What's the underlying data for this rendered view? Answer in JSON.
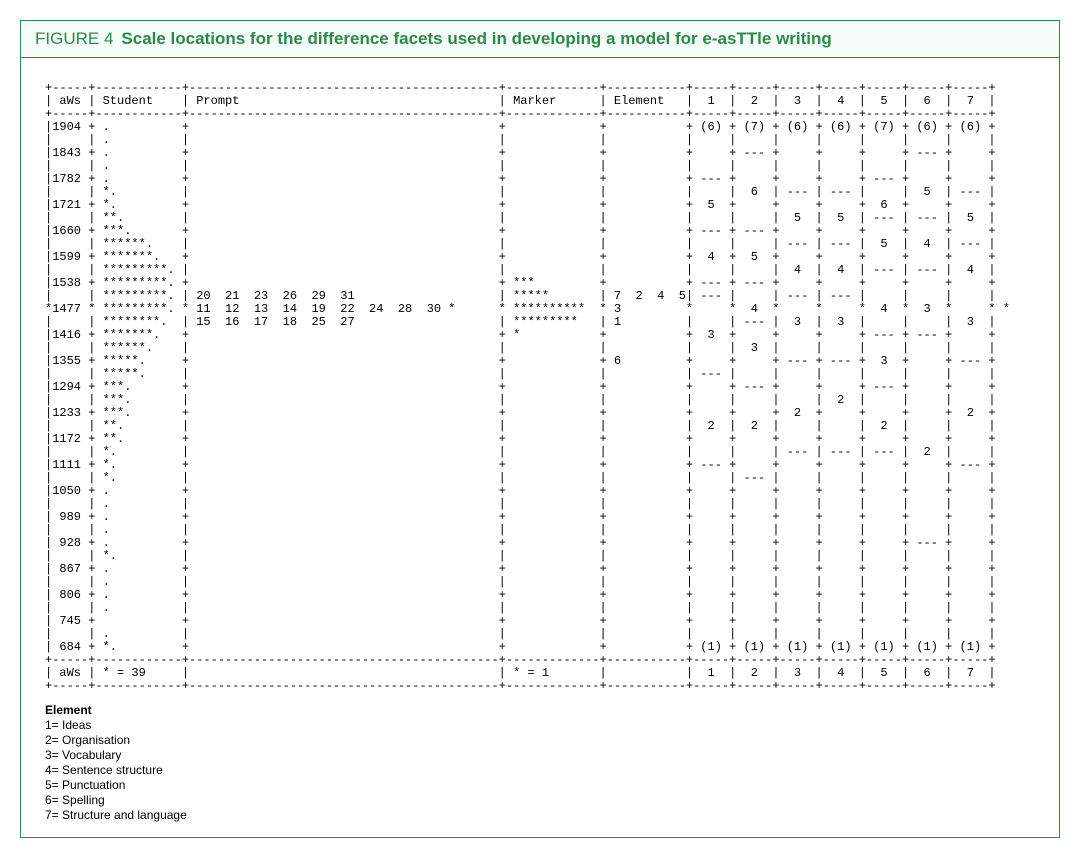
{
  "figure": {
    "label": "FIGURE 4",
    "title": "Scale locations for the difference facets used in developing a model for e-asTTle writing"
  },
  "header": {
    "col1": " aWs ",
    "col2": " Student    ",
    "col3": " Prompt                                    ",
    "col4": " Marker      ",
    "col5": " Element   ",
    "c1": "  1  ",
    "c2": "  2  ",
    "c3": "  3  ",
    "c4": "  4  ",
    "c5": "  5  ",
    "c6": "  6  ",
    "c7": "  7  "
  },
  "rows": [
    {
      "aws": "1904",
      "r": "+",
      "stu": " .          ",
      "pr": "                                           ",
      "mk": "             ",
      "el": "           ",
      "t": "+",
      "c": [
        " (6) ",
        " (7) ",
        " (6) ",
        " (6) ",
        " (7) ",
        " (6) ",
        " (6) "
      ]
    },
    {
      "aws": "    ",
      "r": "|",
      "stu": " .          ",
      "pr": "                                           ",
      "mk": "             ",
      "el": "           ",
      "t": "|",
      "c": [
        "     ",
        "     ",
        "     ",
        "     ",
        "     ",
        "     ",
        "     "
      ]
    },
    {
      "aws": "1843",
      "r": "+",
      "stu": " .          ",
      "pr": "                                           ",
      "mk": "             ",
      "el": "           ",
      "t": "+",
      "c": [
        "     ",
        " --- ",
        "     ",
        "     ",
        "     ",
        " --- ",
        "     "
      ]
    },
    {
      "aws": "    ",
      "r": "|",
      "stu": " .          ",
      "pr": "                                           ",
      "mk": "             ",
      "el": "           ",
      "t": "|",
      "c": [
        "     ",
        "     ",
        "     ",
        "     ",
        "     ",
        "     ",
        "     "
      ]
    },
    {
      "aws": "1782",
      "r": "+",
      "stu": " .          ",
      "pr": "                                           ",
      "mk": "             ",
      "el": "           ",
      "t": "+",
      "c": [
        " --- ",
        "     ",
        "     ",
        "     ",
        " --- ",
        "     ",
        "     "
      ]
    },
    {
      "aws": "    ",
      "r": "|",
      "stu": " *.         ",
      "pr": "                                           ",
      "mk": "             ",
      "el": "           ",
      "t": "|",
      "c": [
        "     ",
        "  6  ",
        " --- ",
        " --- ",
        "     ",
        "  5  ",
        " --- "
      ]
    },
    {
      "aws": "1721",
      "r": "+",
      "stu": " *.         ",
      "pr": "                                           ",
      "mk": "             ",
      "el": "           ",
      "t": "+",
      "c": [
        "  5  ",
        "     ",
        "     ",
        "     ",
        "  6  ",
        "     ",
        "     "
      ]
    },
    {
      "aws": "    ",
      "r": "|",
      "stu": " **.        ",
      "pr": "                                           ",
      "mk": "             ",
      "el": "           ",
      "t": "|",
      "c": [
        "     ",
        "     ",
        "  5  ",
        "  5  ",
        " --- ",
        " --- ",
        "  5  "
      ]
    },
    {
      "aws": "1660",
      "r": "+",
      "stu": " ***.       ",
      "pr": "                                           ",
      "mk": "             ",
      "el": "           ",
      "t": "+",
      "c": [
        " --- ",
        " --- ",
        "     ",
        "     ",
        "     ",
        "     ",
        "     "
      ]
    },
    {
      "aws": "    ",
      "r": "|",
      "stu": " ******.    ",
      "pr": "                                           ",
      "mk": "             ",
      "el": "           ",
      "t": "|",
      "c": [
        "     ",
        "     ",
        " --- ",
        " --- ",
        "  5  ",
        "  4  ",
        " --- "
      ]
    },
    {
      "aws": "1599",
      "r": "+",
      "stu": " *******.   ",
      "pr": "                                           ",
      "mk": "             ",
      "el": "           ",
      "t": "+",
      "c": [
        "  4  ",
        "  5  ",
        "     ",
        "     ",
        "     ",
        "     ",
        "     "
      ]
    },
    {
      "aws": "    ",
      "r": "|",
      "stu": " *********. ",
      "pr": "                                           ",
      "mk": "             ",
      "el": "           ",
      "t": "|",
      "c": [
        "     ",
        "     ",
        "  4  ",
        "  4  ",
        " --- ",
        " --- ",
        "  4  "
      ]
    },
    {
      "aws": "1538",
      "r": "+",
      "stu": " *********. ",
      "pr": "                                           ",
      "mk": " ***         ",
      "el": "           ",
      "t": "+",
      "c": [
        " --- ",
        " --- ",
        "     ",
        "     ",
        "     ",
        "     ",
        "     "
      ]
    },
    {
      "aws": "    ",
      "r": "|",
      "stu": " *********. ",
      "pr": " 20  21  23  26  29  31                    ",
      "mk": " *****       ",
      "el": " 7  2  4  5",
      "t": "|",
      "c": [
        " --- ",
        "     ",
        " --- ",
        " --- ",
        "     ",
        "     ",
        "     "
      ]
    },
    {
      "aws": "1477",
      "r": "*",
      "stu": " *********. ",
      "pr": " 11  12  13  14  19  22  24  28  30 *",
      "mk": " **********  ",
      "el": " 3         ",
      "t": "*",
      "c": [
        "     ",
        "  4  ",
        "     ",
        "     ",
        "  4  ",
        "  3  ",
        "     "
      ]
    },
    {
      "aws": "    ",
      "r": "|",
      "stu": " ********.  ",
      "pr": " 15  16  17  18  25  27                    ",
      "mk": " *********   ",
      "el": " 1         ",
      "t": "|",
      "c": [
        "     ",
        " --- ",
        "  3  ",
        "  3  ",
        "     ",
        "     ",
        "  3  "
      ]
    },
    {
      "aws": "1416",
      "r": "+",
      "stu": " *******.   ",
      "pr": "                                           ",
      "mk": " *           ",
      "el": "           ",
      "t": "+",
      "c": [
        "  3  ",
        "     ",
        "     ",
        "     ",
        " --- ",
        " --- ",
        "     "
      ]
    },
    {
      "aws": "    ",
      "r": "|",
      "stu": " ******.    ",
      "pr": "                                           ",
      "mk": "             ",
      "el": "           ",
      "t": "|",
      "c": [
        "     ",
        "  3  ",
        "     ",
        "     ",
        "     ",
        "     ",
        "     "
      ]
    },
    {
      "aws": "1355",
      "r": "+",
      "stu": " *****.     ",
      "pr": "                                           ",
      "mk": "             ",
      "el": " 6         ",
      "t": "+",
      "c": [
        "     ",
        "     ",
        " --- ",
        " --- ",
        "  3  ",
        "     ",
        " --- "
      ]
    },
    {
      "aws": "    ",
      "r": "|",
      "stu": " *****.     ",
      "pr": "                                           ",
      "mk": "             ",
      "el": "           ",
      "t": "|",
      "c": [
        " --- ",
        "     ",
        "     ",
        "     ",
        "     ",
        "     ",
        "     "
      ]
    },
    {
      "aws": "1294",
      "r": "+",
      "stu": " ***.       ",
      "pr": "                                           ",
      "mk": "             ",
      "el": "           ",
      "t": "+",
      "c": [
        "     ",
        " --- ",
        "     ",
        "     ",
        " --- ",
        "     ",
        "     "
      ]
    },
    {
      "aws": "    ",
      "r": "|",
      "stu": " ***.       ",
      "pr": "                                           ",
      "mk": "             ",
      "el": "           ",
      "t": "|",
      "c": [
        "     ",
        "     ",
        "     ",
        "  2  ",
        "     ",
        "     ",
        "     "
      ]
    },
    {
      "aws": "1233",
      "r": "+",
      "stu": " ***.       ",
      "pr": "                                           ",
      "mk": "             ",
      "el": "           ",
      "t": "+",
      "c": [
        "     ",
        "     ",
        "  2  ",
        "     ",
        "     ",
        "     ",
        "  2  "
      ]
    },
    {
      "aws": "    ",
      "r": "|",
      "stu": " **.        ",
      "pr": "                                           ",
      "mk": "             ",
      "el": "           ",
      "t": "|",
      "c": [
        "  2  ",
        "  2  ",
        "     ",
        "     ",
        "  2  ",
        "     ",
        "     "
      ]
    },
    {
      "aws": "1172",
      "r": "+",
      "stu": " **.        ",
      "pr": "                                           ",
      "mk": "             ",
      "el": "           ",
      "t": "+",
      "c": [
        "     ",
        "     ",
        "     ",
        "     ",
        "     ",
        "     ",
        "     "
      ]
    },
    {
      "aws": "    ",
      "r": "|",
      "stu": " *.         ",
      "pr": "                                           ",
      "mk": "             ",
      "el": "           ",
      "t": "|",
      "c": [
        "     ",
        "     ",
        " --- ",
        " --- ",
        " --- ",
        "  2  ",
        "     "
      ]
    },
    {
      "aws": "1111",
      "r": "+",
      "stu": " *.         ",
      "pr": "                                           ",
      "mk": "             ",
      "el": "           ",
      "t": "+",
      "c": [
        " --- ",
        "     ",
        "     ",
        "     ",
        "     ",
        "     ",
        " --- "
      ]
    },
    {
      "aws": "    ",
      "r": "|",
      "stu": " *.         ",
      "pr": "                                           ",
      "mk": "             ",
      "el": "           ",
      "t": "|",
      "c": [
        "     ",
        " --- ",
        "     ",
        "     ",
        "     ",
        "     ",
        "     "
      ]
    },
    {
      "aws": "1050",
      "r": "+",
      "stu": " .          ",
      "pr": "                                           ",
      "mk": "             ",
      "el": "           ",
      "t": "+",
      "c": [
        "     ",
        "     ",
        "     ",
        "     ",
        "     ",
        "     ",
        "     "
      ]
    },
    {
      "aws": "    ",
      "r": "|",
      "stu": " .          ",
      "pr": "                                           ",
      "mk": "             ",
      "el": "           ",
      "t": "|",
      "c": [
        "     ",
        "     ",
        "     ",
        "     ",
        "     ",
        "     ",
        "     "
      ]
    },
    {
      "aws": " 989",
      "r": "+",
      "stu": " .          ",
      "pr": "                                           ",
      "mk": "             ",
      "el": "           ",
      "t": "+",
      "c": [
        "     ",
        "     ",
        "     ",
        "     ",
        "     ",
        "     ",
        "     "
      ]
    },
    {
      "aws": "    ",
      "r": "|",
      "stu": " .          ",
      "pr": "                                           ",
      "mk": "             ",
      "el": "           ",
      "t": "|",
      "c": [
        "     ",
        "     ",
        "     ",
        "     ",
        "     ",
        "     ",
        "     "
      ]
    },
    {
      "aws": " 928",
      "r": "+",
      "stu": " .          ",
      "pr": "                                           ",
      "mk": "             ",
      "el": "           ",
      "t": "+",
      "c": [
        "     ",
        "     ",
        "     ",
        "     ",
        "     ",
        " --- ",
        "     "
      ]
    },
    {
      "aws": "    ",
      "r": "|",
      "stu": " *.         ",
      "pr": "                                           ",
      "mk": "             ",
      "el": "           ",
      "t": "|",
      "c": [
        "     ",
        "     ",
        "     ",
        "     ",
        "     ",
        "     ",
        "     "
      ]
    },
    {
      "aws": " 867",
      "r": "+",
      "stu": " .          ",
      "pr": "                                           ",
      "mk": "             ",
      "el": "           ",
      "t": "+",
      "c": [
        "     ",
        "     ",
        "     ",
        "     ",
        "     ",
        "     ",
        "     "
      ]
    },
    {
      "aws": "    ",
      "r": "|",
      "stu": " .          ",
      "pr": "                                           ",
      "mk": "             ",
      "el": "           ",
      "t": "|",
      "c": [
        "     ",
        "     ",
        "     ",
        "     ",
        "     ",
        "     ",
        "     "
      ]
    },
    {
      "aws": " 806",
      "r": "+",
      "stu": " .          ",
      "pr": "                                           ",
      "mk": "             ",
      "el": "           ",
      "t": "+",
      "c": [
        "     ",
        "     ",
        "     ",
        "     ",
        "     ",
        "     ",
        "     "
      ]
    },
    {
      "aws": "    ",
      "r": "|",
      "stu": " .          ",
      "pr": "                                           ",
      "mk": "             ",
      "el": "           ",
      "t": "|",
      "c": [
        "     ",
        "     ",
        "     ",
        "     ",
        "     ",
        "     ",
        "     "
      ]
    },
    {
      "aws": " 745",
      "r": "+",
      "stu": "            ",
      "pr": "                                           ",
      "mk": "             ",
      "el": "           ",
      "t": "+",
      "c": [
        "     ",
        "     ",
        "     ",
        "     ",
        "     ",
        "     ",
        "     "
      ]
    },
    {
      "aws": "    ",
      "r": "|",
      "stu": " .          ",
      "pr": "                                           ",
      "mk": "             ",
      "el": "           ",
      "t": "|",
      "c": [
        "     ",
        "     ",
        "     ",
        "     ",
        "     ",
        "     ",
        "     "
      ]
    },
    {
      "aws": " 684",
      "r": "+",
      "stu": " *.         ",
      "pr": "                                           ",
      "mk": "             ",
      "el": "           ",
      "t": "+",
      "c": [
        " (1) ",
        " (1) ",
        " (1) ",
        " (1) ",
        " (1) ",
        " (1) ",
        " (1) "
      ]
    }
  ],
  "footer": {
    "aws": " aWs ",
    "stu": " * = 39     ",
    "pr": "                                           ",
    "mk": " * = 1       ",
    "el": "           ",
    "c": [
      "  1  ",
      "  2  ",
      "  3  ",
      "  4  ",
      "  5  ",
      "  6  ",
      "  7  "
    ]
  },
  "legend": {
    "title": "Element",
    "items": [
      "1= Ideas",
      "2= Organisation",
      "3= Vocabulary",
      "4= Sentence structure",
      "5= Punctuation",
      "6= Spelling",
      "7= Structure and language"
    ]
  }
}
